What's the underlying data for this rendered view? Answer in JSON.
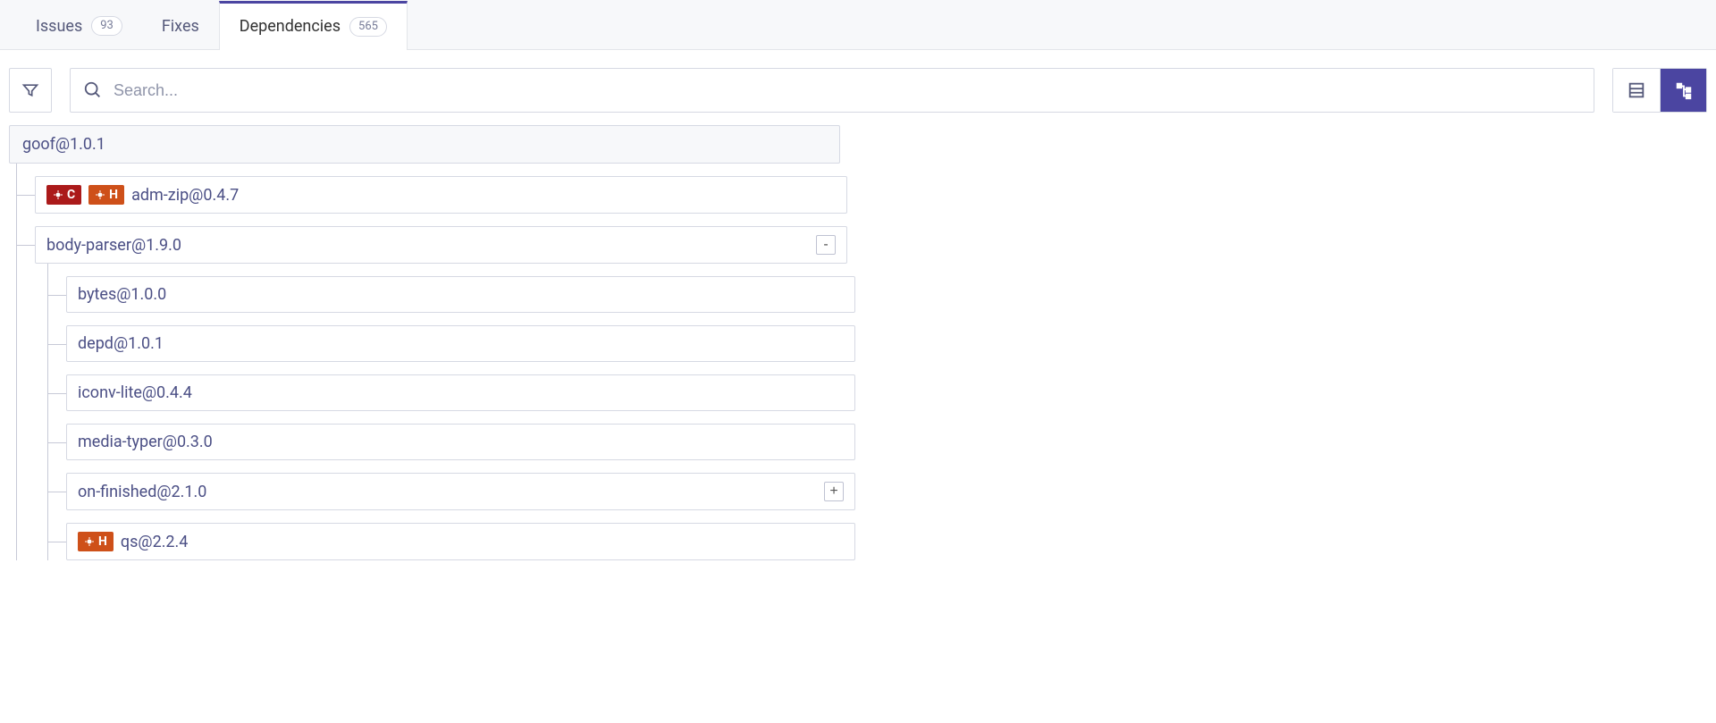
{
  "tabs": [
    {
      "label": "Issues",
      "count": "93"
    },
    {
      "label": "Fixes",
      "count": ""
    },
    {
      "label": "Dependencies",
      "count": "565"
    }
  ],
  "search": {
    "placeholder": "Search..."
  },
  "tree": {
    "root": "goof@1.0.1",
    "children": [
      {
        "name": "adm-zip@0.4.7",
        "badges": [
          {
            "sev": "C"
          },
          {
            "sev": "H"
          }
        ],
        "expand": ""
      },
      {
        "name": "body-parser@1.9.0",
        "badges": [],
        "expand": "-",
        "children": [
          {
            "name": "bytes@1.0.0",
            "badges": [],
            "expand": ""
          },
          {
            "name": "depd@1.0.1",
            "badges": [],
            "expand": ""
          },
          {
            "name": "iconv-lite@0.4.4",
            "badges": [],
            "expand": ""
          },
          {
            "name": "media-typer@0.3.0",
            "badges": [],
            "expand": ""
          },
          {
            "name": "on-finished@2.1.0",
            "badges": [],
            "expand": "+"
          },
          {
            "name": "qs@2.2.4",
            "badges": [
              {
                "sev": "H"
              }
            ],
            "expand": ""
          }
        ]
      }
    ]
  }
}
